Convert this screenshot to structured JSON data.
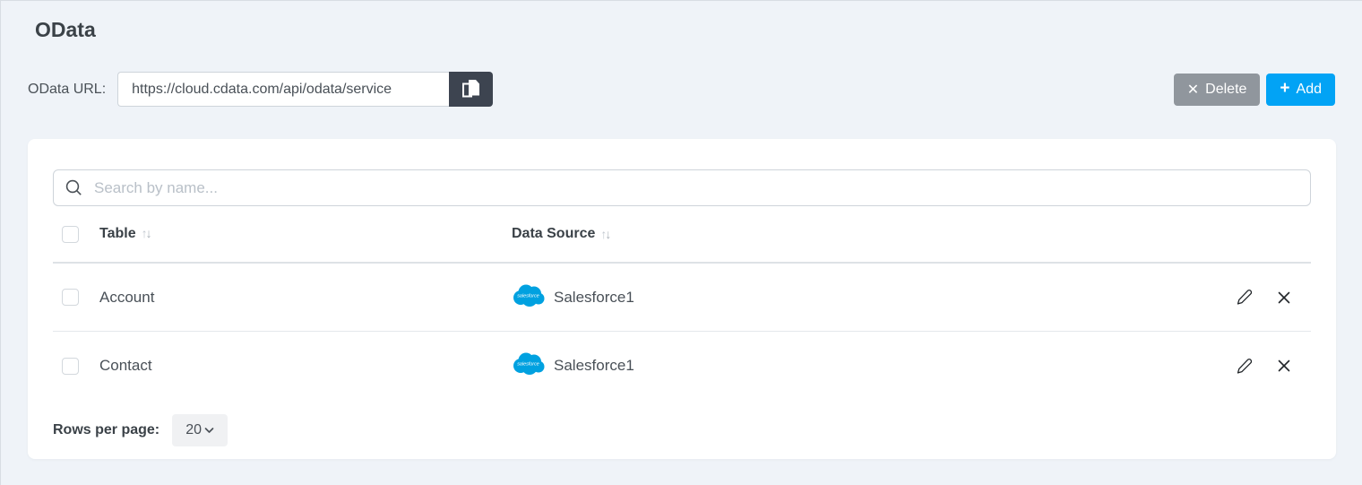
{
  "page": {
    "title": "OData"
  },
  "toolbar": {
    "url_label": "OData URL:",
    "url_value": "https://cloud.cdata.com/api/odata/service",
    "delete_label": "Delete",
    "add_label": "Add"
  },
  "icons": {
    "close": "✕",
    "plus": "+",
    "sort_asc": "↑",
    "sort_desc": "↓"
  },
  "search": {
    "placeholder": "Search by name..."
  },
  "table": {
    "columns": [
      {
        "label": "Table",
        "sortable": true
      },
      {
        "label": "Data Source",
        "sortable": true
      }
    ],
    "rows": [
      {
        "table": "Account",
        "data_source": "Salesforce1",
        "source_icon": "salesforce-cloud-icon",
        "source_logo_text": "salesforce"
      },
      {
        "table": "Contact",
        "data_source": "Salesforce1",
        "source_icon": "salesforce-cloud-icon",
        "source_logo_text": "salesforce"
      }
    ]
  },
  "pagination": {
    "label": "Rows per page:",
    "selected_value": "20"
  },
  "colors": {
    "page_background": "#eff3f8",
    "card_background": "#ffffff",
    "accent_blue": "#02a3f5",
    "delete_gray": "#90969d",
    "copy_button_dark": "#3d4450",
    "salesforce_blue": "#00a1e0",
    "heading_text": "#3b4248",
    "body_text": "#495057",
    "placeholder_text": "#b9c0c8",
    "divider": "#dee2e6"
  }
}
